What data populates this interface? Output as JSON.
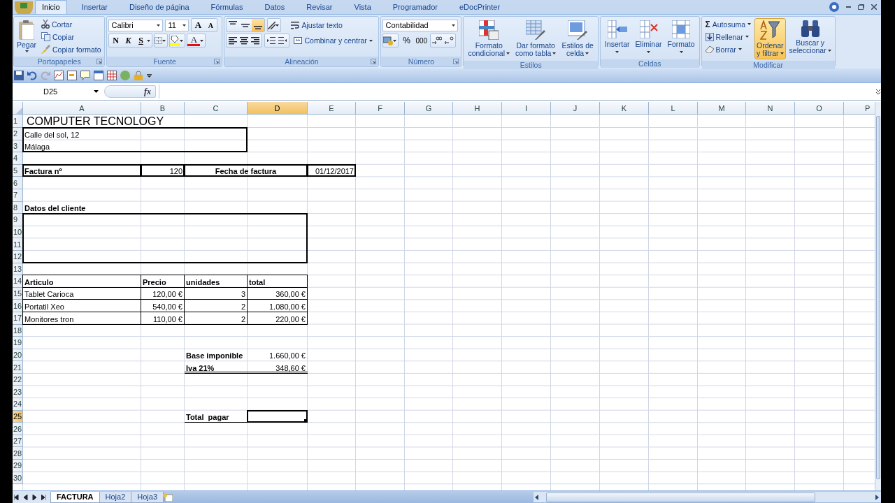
{
  "ribbon": {
    "tabs": [
      {
        "label": "Inicio",
        "selected": true
      },
      {
        "label": "Insertar",
        "selected": false
      },
      {
        "label": "Diseño de página",
        "selected": false
      },
      {
        "label": "Fórmulas",
        "selected": false
      },
      {
        "label": "Datos",
        "selected": false
      },
      {
        "label": "Revisar",
        "selected": false
      },
      {
        "label": "Vista",
        "selected": false
      },
      {
        "label": "Programador",
        "selected": false
      },
      {
        "label": "eDocPrinter",
        "selected": false
      }
    ],
    "groups": [
      {
        "kind": "clipboard",
        "label": "Portapapeles",
        "large": "Pegar",
        "small": [
          "Cortar",
          "Copiar",
          "Copiar formato"
        ]
      },
      {
        "kind": "font",
        "label": "Fuente",
        "font": "Calibri",
        "size": "11",
        "grow": "A",
        "shrink": "A",
        "styles": [
          "N",
          "K",
          "S"
        ],
        "font_color": "A"
      },
      {
        "kind": "alignment",
        "label": "Alineación",
        "vertical_align": [
          {
            "selected": false
          },
          {
            "selected": false
          },
          {
            "selected": true
          }
        ],
        "wrap": "Ajustar texto",
        "merge": "Combinar y centrar"
      },
      {
        "kind": "number",
        "label": "Número",
        "format": "Contabilidad",
        "percent": "%",
        "thousands": "000"
      },
      {
        "kind": "large",
        "label": "Estilos",
        "buttons": [
          {
            "lines": [
              "Formato",
              "condicional"
            ],
            "highlighted": false
          },
          {
            "lines": [
              "Dar formato",
              "como tabla"
            ],
            "highlighted": false
          },
          {
            "lines": [
              "Estilos de",
              "celda"
            ],
            "highlighted": false
          }
        ]
      },
      {
        "kind": "large",
        "label": "Celdas",
        "buttons": [
          {
            "lines": [
              "Insertar"
            ],
            "highlighted": false
          },
          {
            "lines": [
              "Eliminar"
            ],
            "highlighted": false
          },
          {
            "lines": [
              "Formato"
            ],
            "highlighted": false
          }
        ]
      },
      {
        "kind": "editing",
        "label": "Modificar",
        "sigma": "Σ",
        "small": [
          "Autosuma",
          "Rellenar",
          "Borrar"
        ],
        "buttons": [
          {
            "lines": [
              "Ordenar",
              "y filtrar"
            ],
            "highlighted": true
          },
          {
            "lines": [
              "Buscar y",
              "seleccionar"
            ],
            "highlighted": false
          }
        ]
      }
    ]
  },
  "formula_bar": {
    "name_box": "D25",
    "function_label": "fx"
  },
  "sheet": {
    "columns": [
      {
        "label": "A",
        "selected": false
      },
      {
        "label": "B",
        "selected": false
      },
      {
        "label": "C",
        "selected": false
      },
      {
        "label": "D",
        "selected": true
      },
      {
        "label": "E",
        "selected": false
      },
      {
        "label": "F",
        "selected": false
      },
      {
        "label": "G",
        "selected": false
      },
      {
        "label": "H",
        "selected": false
      },
      {
        "label": "I",
        "selected": false
      },
      {
        "label": "J",
        "selected": false
      },
      {
        "label": "K",
        "selected": false
      },
      {
        "label": "L",
        "selected": false
      },
      {
        "label": "M",
        "selected": false
      },
      {
        "label": "N",
        "selected": false
      },
      {
        "label": "O",
        "selected": false
      },
      {
        "label": "P",
        "selected": false
      }
    ],
    "rows": [
      {
        "number": "1",
        "selected": false,
        "cells": [
          {
            "text": "COMPUTER TECNOLOGY",
            "bold": false,
            "kind": "title"
          }
        ]
      },
      {
        "number": "2",
        "selected": false,
        "cells": [
          {
            "text": "Calle del sol, 12",
            "bold": false
          }
        ]
      },
      {
        "number": "3",
        "selected": false,
        "cells": [
          {
            "text": "Málaga",
            "bold": false
          }
        ]
      },
      {
        "number": "4",
        "selected": false
      },
      {
        "number": "5",
        "selected": false,
        "cells": [
          {
            "text": "Factura nº",
            "bold": true
          },
          {
            "text": "120",
            "bold": false
          },
          {
            "text": "Fecha de factura",
            "bold": true,
            "kind": "merged"
          },
          "",
          {
            "text": "01/12/2017",
            "bold": false
          }
        ]
      },
      {
        "number": "6",
        "selected": false
      },
      {
        "number": "7",
        "selected": false
      },
      {
        "number": "8",
        "selected": false,
        "cells": [
          {
            "text": "Datos del cliente",
            "bold": true
          }
        ]
      },
      {
        "number": "9",
        "selected": false
      },
      {
        "number": "10",
        "selected": false
      },
      {
        "number": "11",
        "selected": false
      },
      {
        "number": "12",
        "selected": false
      },
      {
        "number": "13",
        "selected": false
      },
      {
        "number": "14",
        "selected": false,
        "cells": [
          {
            "text": "Articulo",
            "bold": true
          },
          {
            "text": "Precio",
            "bold": true
          },
          {
            "text": "unidades",
            "bold": true
          },
          {
            "text": "total",
            "bold": true
          }
        ]
      },
      {
        "number": "15",
        "selected": false,
        "cells": [
          {
            "text": "Tablet Carioca",
            "bold": false
          },
          {
            "text": "120,00 €",
            "bold": false
          },
          {
            "text": "3",
            "bold": false
          },
          {
            "text": "360,00 €",
            "bold": false
          }
        ]
      },
      {
        "number": "16",
        "selected": false,
        "cells": [
          {
            "text": "Portatil Xeo",
            "bold": false
          },
          {
            "text": "540,00 €",
            "bold": false
          },
          {
            "text": "2",
            "bold": false
          },
          {
            "text": "1.080,00 €",
            "bold": false
          }
        ]
      },
      {
        "number": "17",
        "selected": false,
        "cells": [
          {
            "text": "Monitores tron",
            "bold": false
          },
          {
            "text": "110,00 €",
            "bold": false
          },
          {
            "text": "2",
            "bold": false
          },
          {
            "text": "220,00 €",
            "bold": false
          }
        ]
      },
      {
        "number": "18",
        "selected": false
      },
      {
        "number": "19",
        "selected": false
      },
      {
        "number": "20",
        "selected": false,
        "cells": [
          "",
          "",
          {
            "text": "Base imponible",
            "bold": true
          },
          {
            "text": "1.660,00 €",
            "bold": false
          }
        ]
      },
      {
        "number": "21",
        "selected": false,
        "cells": [
          "",
          "",
          {
            "text": "Iva 21%",
            "bold": true
          },
          {
            "text": "348,60 €",
            "bold": false
          }
        ]
      },
      {
        "number": "22",
        "selected": false
      },
      {
        "number": "23",
        "selected": false
      },
      {
        "number": "24",
        "selected": false
      },
      {
        "number": "25",
        "selected": true,
        "cells": [
          "",
          "",
          {
            "text": "Total  pagar",
            "bold": true
          }
        ]
      },
      {
        "number": "26",
        "selected": false
      },
      {
        "number": "27",
        "selected": false
      },
      {
        "number": "28",
        "selected": false
      },
      {
        "number": "29",
        "selected": false
      },
      {
        "number": "30",
        "selected": false
      }
    ]
  },
  "sheet_tabs": [
    {
      "label": "FACTURA",
      "selected": true
    },
    {
      "label": "Hoja2",
      "selected": false
    },
    {
      "label": "Hoja3",
      "selected": false
    }
  ]
}
